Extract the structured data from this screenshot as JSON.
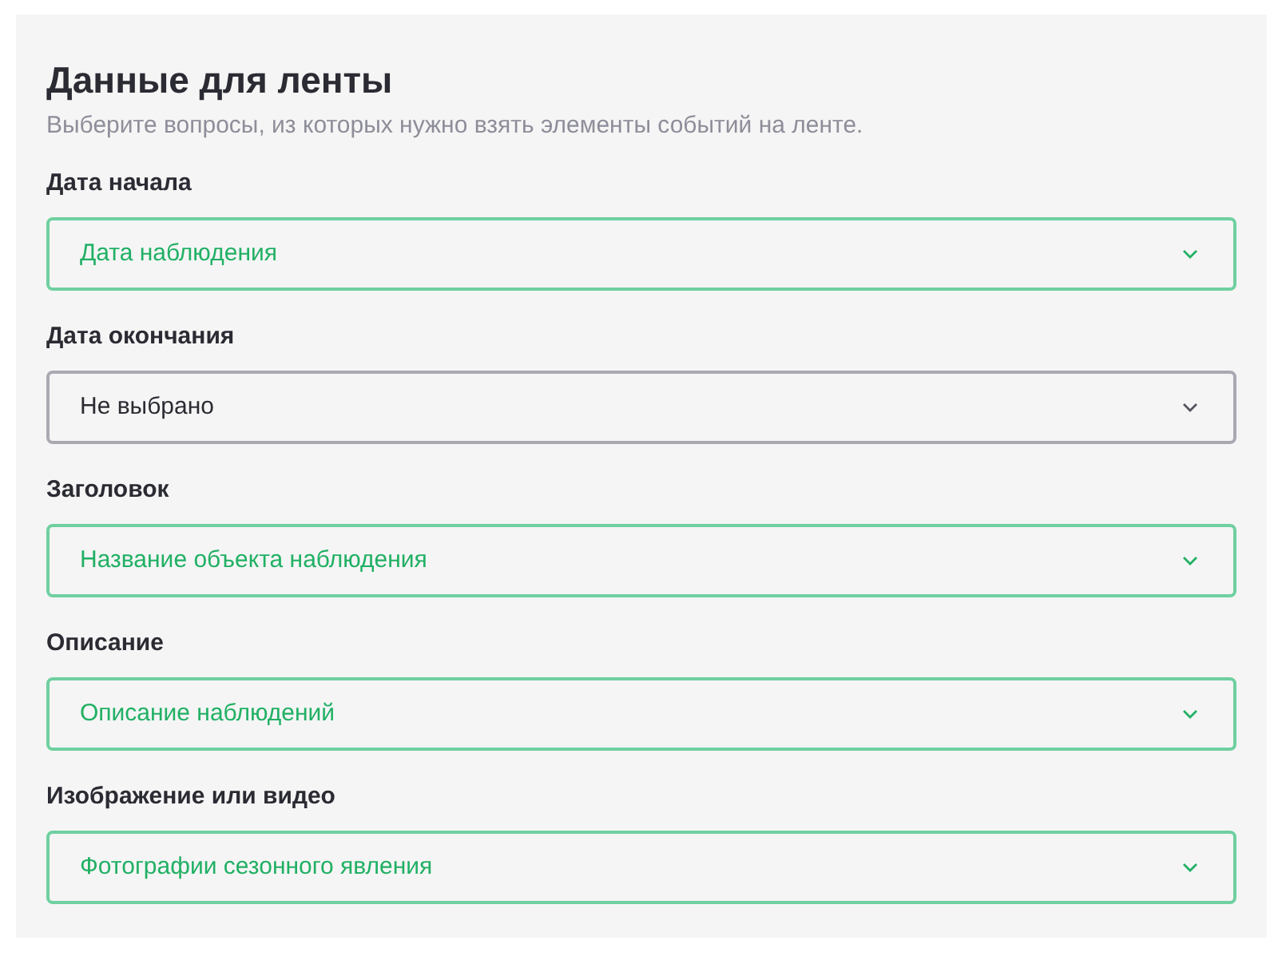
{
  "title": "Данные для ленты",
  "description": "Выберите вопросы, из которых нужно взять элементы событий на ленте.",
  "fields": [
    {
      "label": "Дата начала",
      "value": "Дата наблюдения",
      "filled": true
    },
    {
      "label": "Дата окончания",
      "value": "Не выбрано",
      "filled": false
    },
    {
      "label": "Заголовок",
      "value": "Название объекта наблюдения",
      "filled": true
    },
    {
      "label": "Описание",
      "value": "Описание наблюдений",
      "filled": true
    },
    {
      "label": "Изображение или видео",
      "value": "Фотографии сезонного явления",
      "filled": true
    }
  ]
}
